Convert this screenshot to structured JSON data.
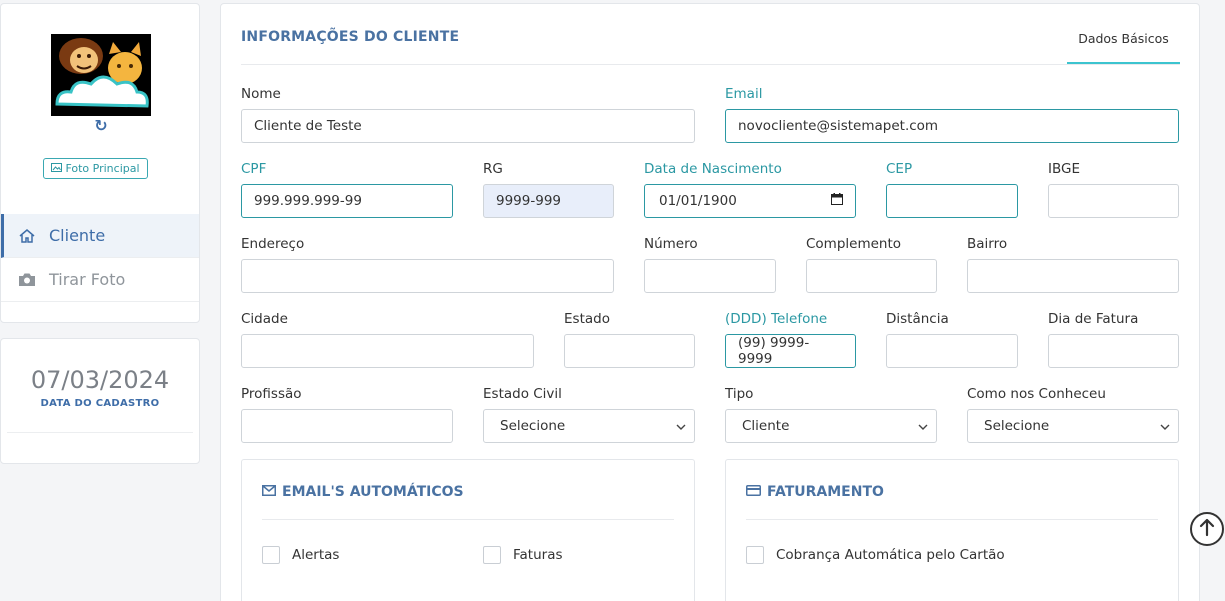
{
  "sidebar": {
    "refresh_glyph": "↻",
    "foto_label": "Foto Principal",
    "nav": [
      {
        "label": "Cliente",
        "icon": "home-icon",
        "active": true
      },
      {
        "label": "Tirar Foto",
        "icon": "camera-icon",
        "active": false
      }
    ],
    "cadastro_date": "07/03/2024",
    "cadastro_label": "DATA DO CADASTRO"
  },
  "header": {
    "title": "INFORMAÇÕES DO CLIENTE",
    "tab_label": "Dados Básicos"
  },
  "form": {
    "nome": {
      "label": "Nome",
      "value": "Cliente de Teste"
    },
    "email": {
      "label": "Email",
      "value": "novocliente@sistemapet.com"
    },
    "cpf": {
      "label": "CPF",
      "value": "999.999.999-99"
    },
    "rg": {
      "label": "RG",
      "value": "9999-999"
    },
    "nascimento": {
      "label": "Data de Nascimento",
      "value": "01/01/1900"
    },
    "cep": {
      "label": "CEP",
      "value": ""
    },
    "ibge": {
      "label": "IBGE",
      "value": ""
    },
    "endereco": {
      "label": "Endereço",
      "value": ""
    },
    "numero": {
      "label": "Número",
      "value": ""
    },
    "complemento": {
      "label": "Complemento",
      "value": ""
    },
    "bairro": {
      "label": "Bairro",
      "value": ""
    },
    "cidade": {
      "label": "Cidade",
      "value": ""
    },
    "estado": {
      "label": "Estado",
      "value": ""
    },
    "telefone": {
      "label": "(DDD) Telefone",
      "value": "(99) 9999-9999"
    },
    "distancia": {
      "label": "Distância",
      "value": ""
    },
    "dia_fatura": {
      "label": "Dia de Fatura",
      "value": ""
    },
    "profissao": {
      "label": "Profissão",
      "value": ""
    },
    "estado_civil": {
      "label": "Estado Civil",
      "selected": "Selecione"
    },
    "tipo": {
      "label": "Tipo",
      "selected": "Cliente"
    },
    "como_conheceu": {
      "label": "Como nos Conheceu",
      "selected": "Selecione"
    }
  },
  "emails_section": {
    "title": "EMAIL'S AUTOMÁTICOS",
    "icon": "envelope-icon",
    "options": [
      {
        "label": "Alertas",
        "checked": false
      },
      {
        "label": "Faturas",
        "checked": false
      }
    ]
  },
  "billing_section": {
    "title": "FATURAMENTO",
    "icon": "credit-card-icon",
    "options": [
      {
        "label": "Cobrança Automática pelo Cartão",
        "checked": false
      }
    ]
  },
  "colors": {
    "accent": "#3e6da8",
    "teal": "#2b98a3",
    "tab_underline": "#3cc4cf"
  }
}
